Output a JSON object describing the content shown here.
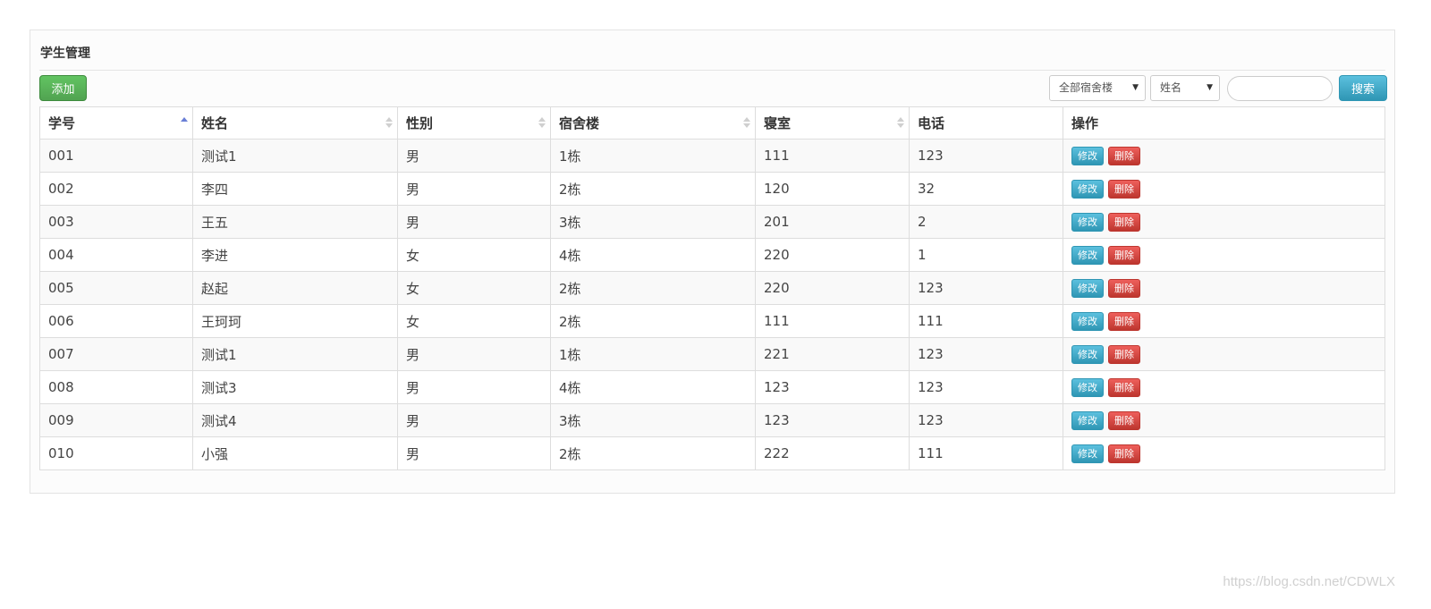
{
  "panel": {
    "title": "学生管理"
  },
  "toolbar": {
    "add_label": "添加",
    "building_select": "全部宿舍楼",
    "field_select": "姓名",
    "search_value": "",
    "search_label": "搜索"
  },
  "table": {
    "columns": [
      "学号",
      "姓名",
      "性别",
      "宿舍楼",
      "寝室",
      "电话",
      "操作"
    ],
    "rows": [
      [
        "001",
        "测试1",
        "男",
        "1栋",
        "111",
        "123"
      ],
      [
        "002",
        "李四",
        "男",
        "2栋",
        "120",
        "32"
      ],
      [
        "003",
        "王五",
        "男",
        "3栋",
        "201",
        "2"
      ],
      [
        "004",
        "李进",
        "女",
        "4栋",
        "220",
        "1"
      ],
      [
        "005",
        "赵起",
        "女",
        "2栋",
        "220",
        "123"
      ],
      [
        "006",
        "王珂珂",
        "女",
        "2栋",
        "111",
        "111"
      ],
      [
        "007",
        "测试1",
        "男",
        "1栋",
        "221",
        "123"
      ],
      [
        "008",
        "测试3",
        "男",
        "4栋",
        "123",
        "123"
      ],
      [
        "009",
        "测试4",
        "男",
        "3栋",
        "123",
        "123"
      ],
      [
        "010",
        "小强",
        "男",
        "2栋",
        "222",
        "111"
      ]
    ],
    "edit_label": "修改",
    "delete_label": "删除"
  },
  "watermark": "https://blog.csdn.net/CDWLX",
  "colors": {
    "add_button": "#51a351",
    "search_button": "#2f96b4",
    "edit_button": "#2f96b4",
    "delete_button": "#bd362f",
    "sort_active": "#6a7fd6"
  }
}
